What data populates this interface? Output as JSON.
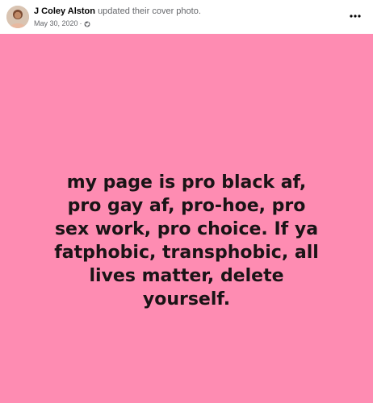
{
  "post": {
    "author": "J Coley Alston",
    "action": "updated their cover photo.",
    "date": "May 30, 2020",
    "separator": "·",
    "privacy_icon": "globe-icon",
    "more_icon": "more-horizontal-icon"
  },
  "cover_photo": {
    "background_color": "#fe8cb2",
    "text_color": "#1a1416",
    "lines": [
      "my page is pro black af,",
      "pro gay af, pro-hoe, pro",
      "sex work, pro choice. If ya",
      "fatphobic, transphobic, all",
      "lives matter, delete",
      "yourself."
    ]
  }
}
